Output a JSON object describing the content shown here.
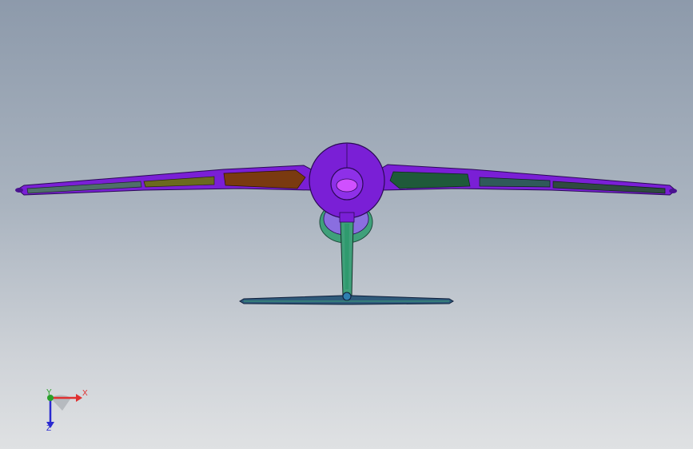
{
  "viewport": {
    "background_top": "#8d9aab",
    "background_bottom": "#dfe1e3"
  },
  "model": {
    "body_color": "#7a1fd6",
    "edge_color": "#2a0a55",
    "panel_colors": [
      "#4f6f6a",
      "#6b6a1f",
      "#7a3a10",
      "#1f5a3a",
      "#2f5a5a",
      "#2f4a40",
      "#3fa07a",
      "#2e7fb0"
    ]
  },
  "triad": {
    "x_label": "X",
    "y_label": "Y",
    "z_label": "Z",
    "x_color": "#e03030",
    "y_color": "#2aa02a",
    "z_color": "#2a2ad0"
  }
}
